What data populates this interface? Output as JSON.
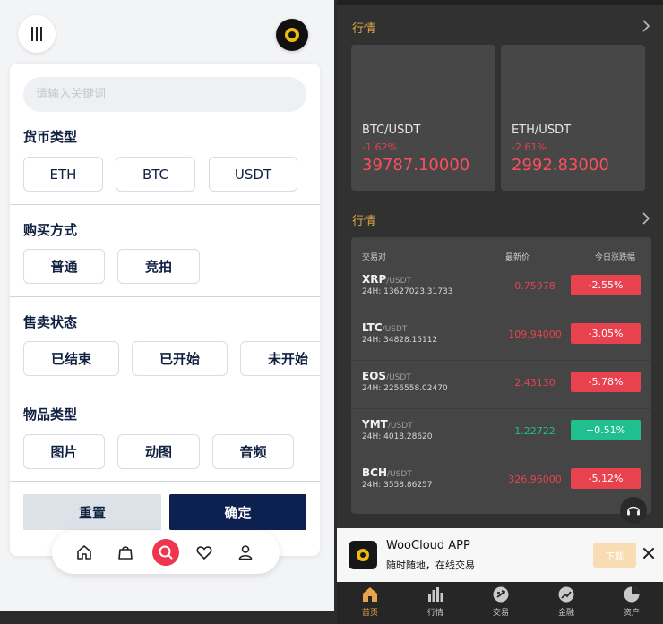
{
  "filter": {
    "search_placeholder": "请输入关键词",
    "sections": [
      {
        "title": "货币类型",
        "options": [
          "ETH",
          "BTC",
          "USDT"
        ]
      },
      {
        "title": "购买方式",
        "options": [
          "普通",
          "竞拍"
        ]
      },
      {
        "title": "售卖状态",
        "options": [
          "已结束",
          "已开始",
          "未开始"
        ]
      },
      {
        "title": "物品类型",
        "options": [
          "图片",
          "动图",
          "音频"
        ]
      }
    ],
    "reset_label": "重置",
    "confirm_label": "确定"
  },
  "tabbar": {
    "items": [
      "home-icon",
      "bag-icon",
      "search-icon",
      "heart-icon",
      "user-icon"
    ],
    "active": "search-icon",
    "active_color": "#f0354f"
  },
  "market": {
    "section1_title": "行情",
    "section2_title": "行情",
    "cards": [
      {
        "pair": "BTC/USDT",
        "change": "-1.62%",
        "price": "39787.10000"
      },
      {
        "pair": "ETH/USDT",
        "change": "-2.61%",
        "price": "2992.83000"
      }
    ],
    "table_headers": {
      "pair": "交易对",
      "price": "最新价",
      "change": "今日涨跌幅"
    },
    "rows": [
      {
        "symbol": "XRP",
        "quote": "/USDT",
        "volume": "24H: 13627023.31733",
        "price": "0.75978",
        "change": "-2.55%",
        "up": false
      },
      {
        "symbol": "LTC",
        "quote": "/USDT",
        "volume": "24H: 34828.15112",
        "price": "109.94000",
        "change": "-3.05%",
        "up": false
      },
      {
        "symbol": "EOS",
        "quote": "/USDT",
        "volume": "24H: 2256558.02470",
        "price": "2.43130",
        "change": "-5.78%",
        "up": false
      },
      {
        "symbol": "YMT",
        "quote": "/USDT",
        "volume": "24H: 4018.28620",
        "price": "1.22722",
        "change": "+0.51%",
        "up": true
      },
      {
        "symbol": "BCH",
        "quote": "/USDT",
        "volume": "24H: 3558.86257",
        "price": "326.96000",
        "change": "-5.12%",
        "up": false
      }
    ],
    "colors": {
      "down": "#e8424f",
      "up": "#1fbf90",
      "accent": "#d9a64a"
    }
  },
  "banner": {
    "title": "WooCloud APP",
    "subtitle": "随时随地，在线交易",
    "download_label": "下载"
  },
  "bottom_nav": {
    "items": [
      {
        "label": "首页",
        "icon": "home-icon",
        "active": true
      },
      {
        "label": "行情",
        "icon": "chart-icon",
        "active": false
      },
      {
        "label": "交易",
        "icon": "trade-icon",
        "active": false
      },
      {
        "label": "金融",
        "icon": "finance-icon",
        "active": false
      },
      {
        "label": "资产",
        "icon": "assets-icon",
        "active": false
      }
    ]
  }
}
